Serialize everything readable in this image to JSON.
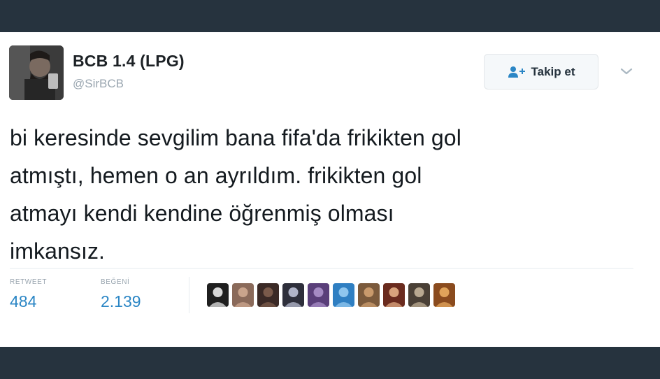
{
  "user": {
    "display_name": "BCB 1.4 (LPG)",
    "handle": "@SirBCB"
  },
  "follow_button": {
    "label": "Takip et",
    "icon": "follow-person-icon"
  },
  "menu": {
    "icon": "chevron-down-icon"
  },
  "tweet": {
    "text": "bi keresinde sevgilim bana fifa'da frikikten gol\natmıştı, hemen o an ayrıldım. frikikten gol\natmayı kendi kendine öğrenmiş olması\nimkansız."
  },
  "stats": {
    "retweet_label": "RETWEET",
    "retweet_count": "484",
    "likes_label": "BEĞENİ",
    "likes_count": "2.139"
  },
  "likers": [
    {
      "color": "#1f1f1f",
      "accent": "#d8d8d8"
    },
    {
      "color": "#8a6a5a",
      "accent": "#c9a48c"
    },
    {
      "color": "#3b2a26",
      "accent": "#7a5a4a"
    },
    {
      "color": "#2e2f3b",
      "accent": "#b0b4c8"
    },
    {
      "color": "#5a3f7a",
      "accent": "#a58bc4"
    },
    {
      "color": "#2f7fc2",
      "accent": "#8fc6ee"
    },
    {
      "color": "#7b5a3c",
      "accent": "#c99a6c"
    },
    {
      "color": "#6a2b1e",
      "accent": "#d9a37c"
    },
    {
      "color": "#4a4036",
      "accent": "#b8a890"
    },
    {
      "color": "#8a4b1e",
      "accent": "#e0a35a"
    }
  ],
  "colors": {
    "background": "#26333e",
    "link_blue": "#2b86c5",
    "text_dark": "#141a1f",
    "text_muted": "#9aa6b0"
  }
}
